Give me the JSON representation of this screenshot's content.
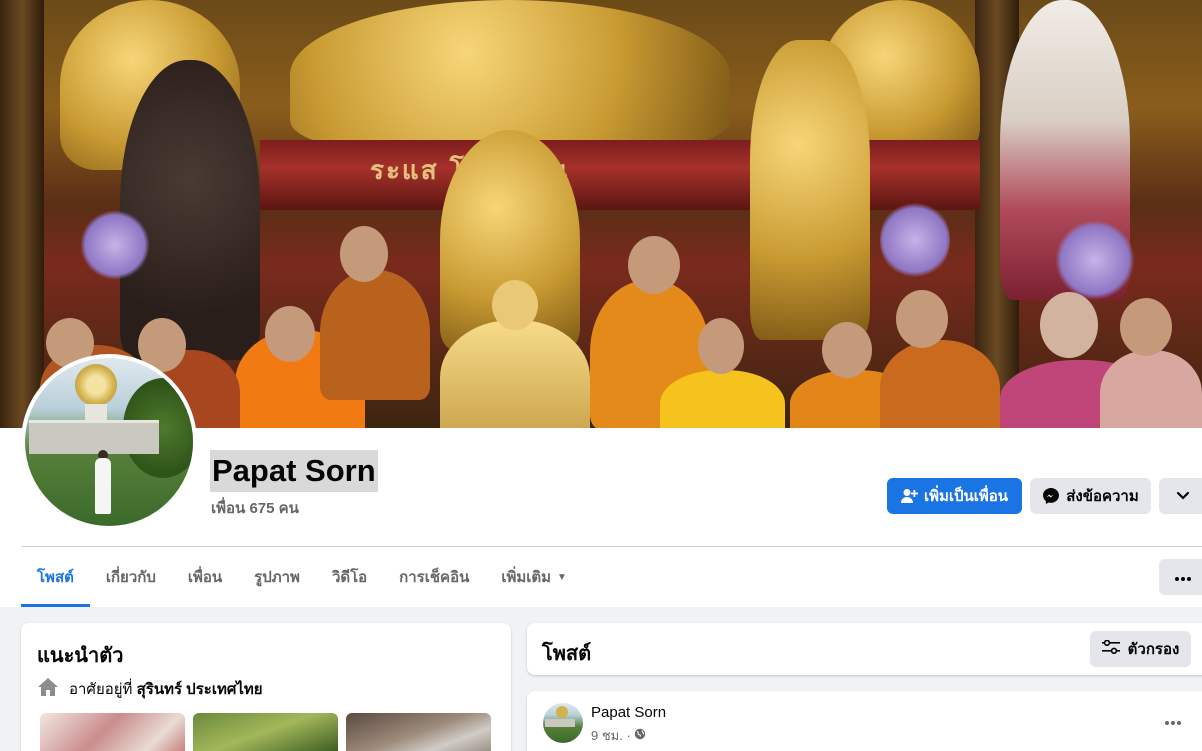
{
  "profile": {
    "name": "Papat Sorn",
    "friends": "เพื่อน 675 คน"
  },
  "actions": {
    "add_friend": "เพิ่มเป็นเพื่อน",
    "message": "ส่งข้อความ"
  },
  "tabs": [
    {
      "label": "โพสต์",
      "active": true
    },
    {
      "label": "เกี่ยวกับ"
    },
    {
      "label": "เพื่อน"
    },
    {
      "label": "รูปภาพ"
    },
    {
      "label": "วิดีโอ"
    },
    {
      "label": "การเช็คอิน"
    },
    {
      "label": "เพิ่มเติม"
    }
  ],
  "intro": {
    "title": "แนะนำตัว",
    "lives_prefix": "อาศัยอยู่ที่",
    "lives_place": "สุรินทร์ ประเทศไทย"
  },
  "posts": {
    "title": "โพสต์",
    "filter_label": "ตัวกรอง"
  },
  "post": {
    "author": "Papat Sorn",
    "time": "9 ชม. ·"
  },
  "cover_text": "ระแส    โพธิญาณ",
  "colors": {
    "accent": "#1b74e4",
    "secondary_button": "#e4e6eb",
    "background": "#f0f2f5"
  }
}
